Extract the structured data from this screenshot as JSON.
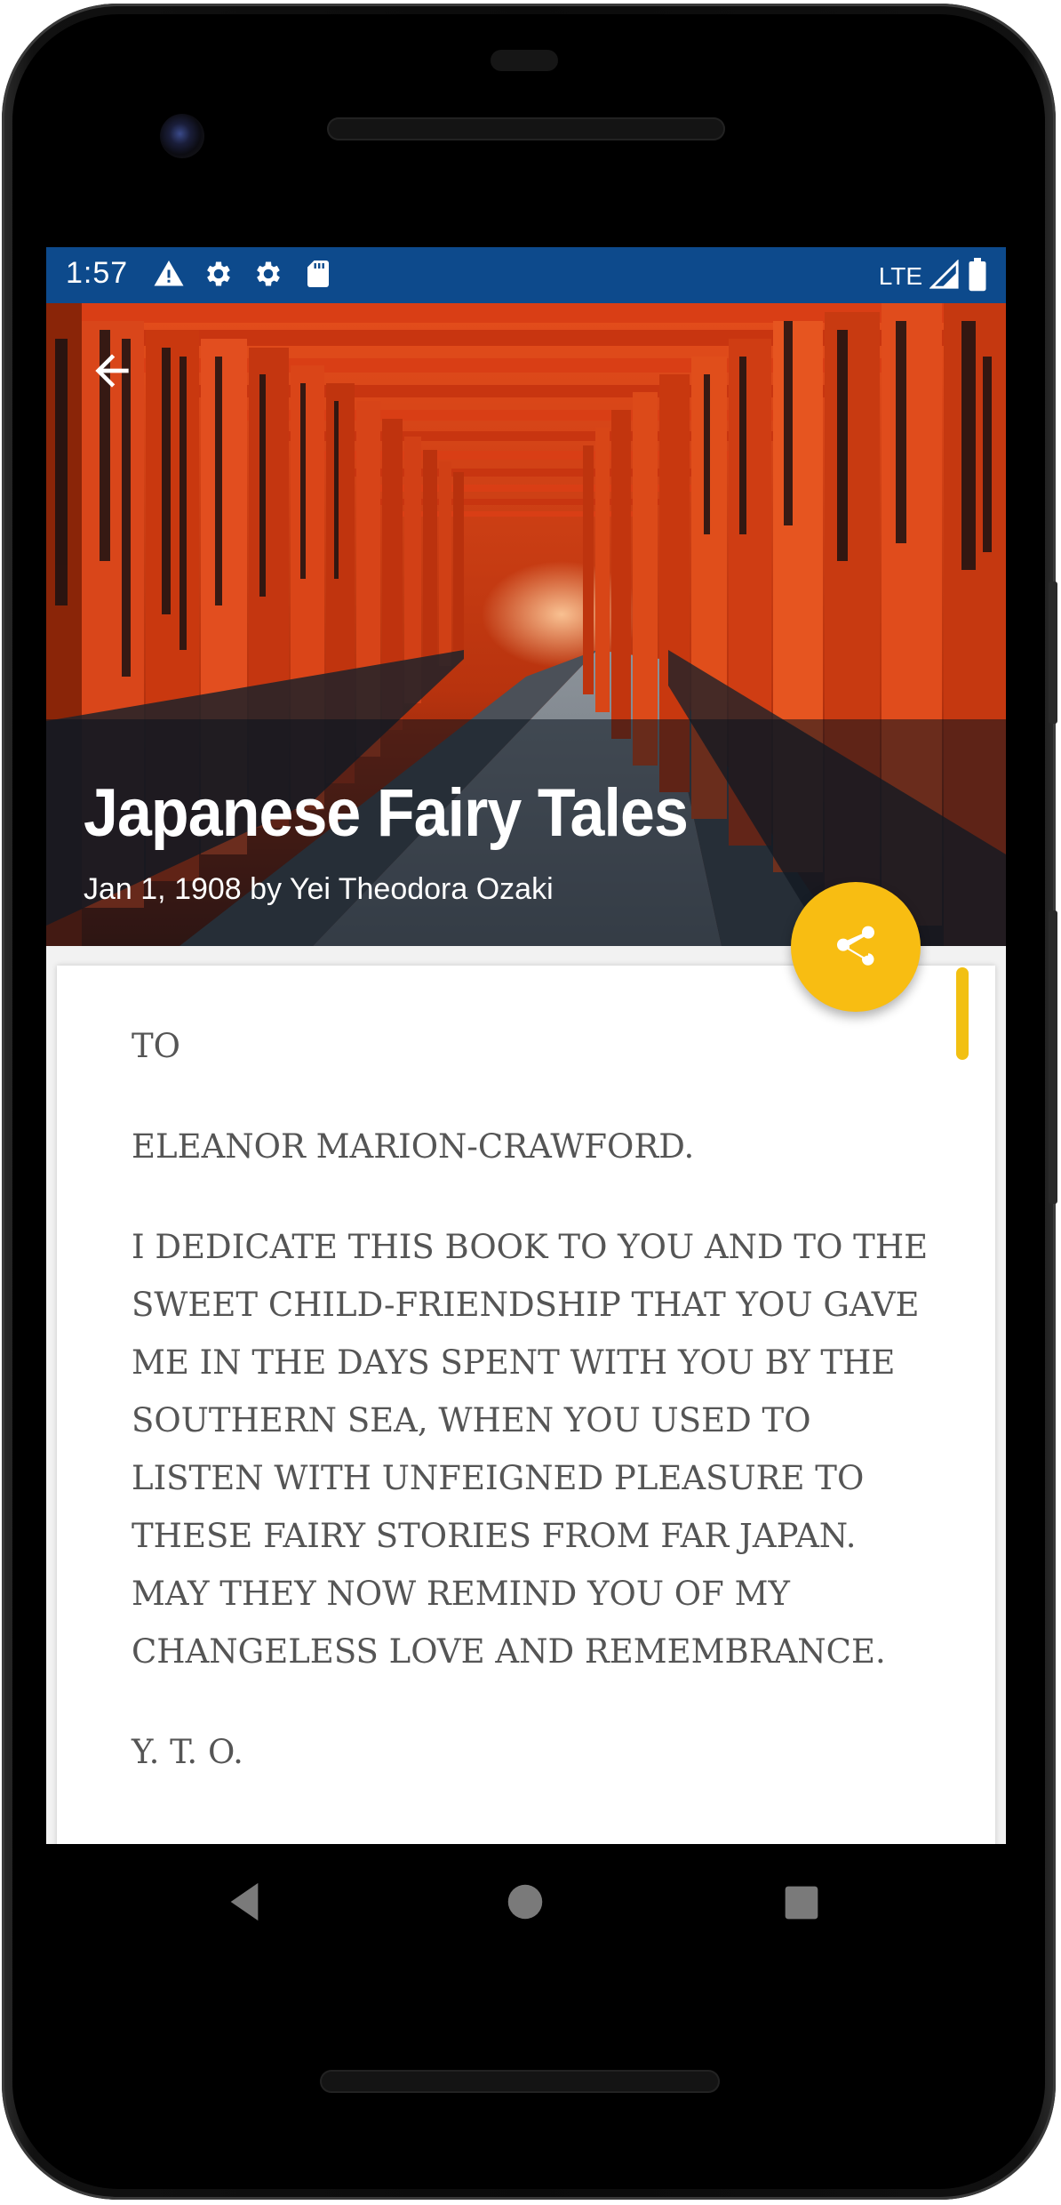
{
  "status_bar": {
    "time": "1:57",
    "network": "LTE",
    "icons": [
      "warning-icon",
      "gear-icon",
      "gear-icon",
      "sd-card-icon"
    ]
  },
  "hero": {
    "title": "Japanese Fairy Tales",
    "subtitle": "Jan 1, 1908 by Yei Theodora Ozaki",
    "back_icon": "arrow-back-icon",
    "share_icon": "share-icon"
  },
  "content": {
    "paragraphs": [
      "TO",
      "ELEANOR MARION-CRAWFORD.",
      "I DEDICATE THIS BOOK TO YOU AND TO THE SWEET CHILD-FRIENDSHIP THAT YOU GAVE ME IN THE DAYS SPENT WITH YOU BY THE SOUTHERN SEA, WHEN YOU USED TO LISTEN WITH UNFEIGNED PLEASURE TO THESE FAIRY STORIES FROM FAR JAPAN. MAY THEY NOW REMIND YOU OF MY CHANGELESS LOVE AND REMEMBRANCE.",
      "Y. T. O."
    ]
  },
  "nav_bar": {
    "back": "nav-back-icon",
    "home": "nav-home-icon",
    "recents": "nav-recents-icon"
  },
  "colors": {
    "status_bar": "#0d4a8c",
    "fab": "#f8bd12",
    "torii": "#d8441a"
  }
}
